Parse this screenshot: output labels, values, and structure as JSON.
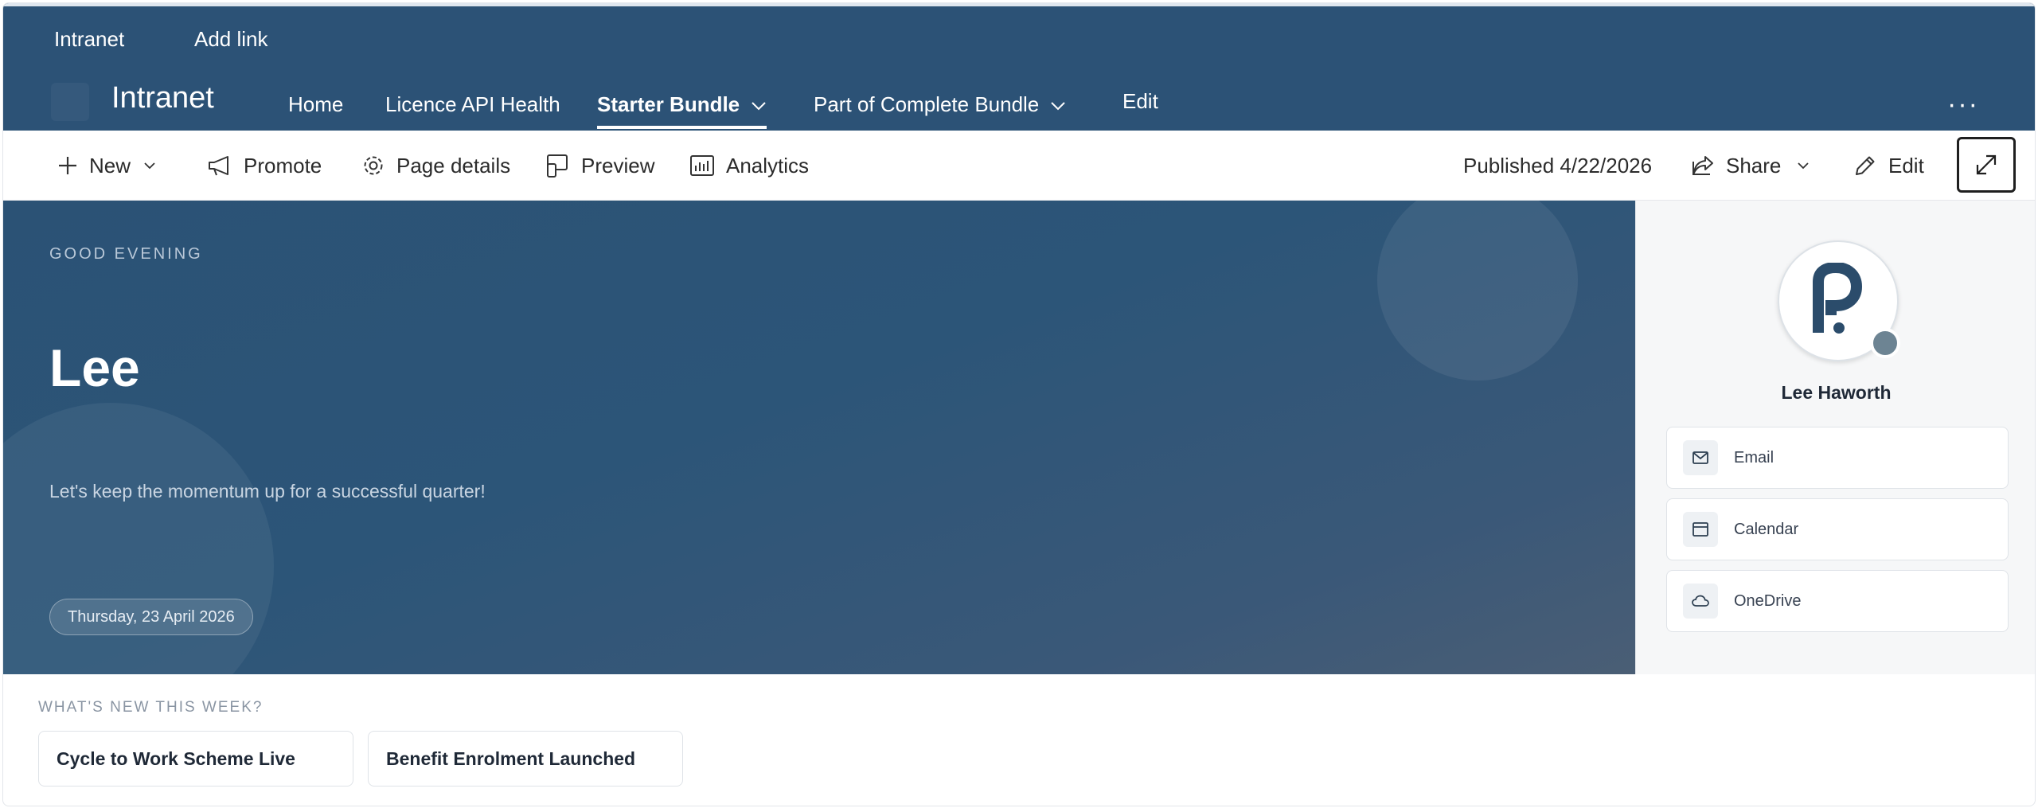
{
  "suite_bar": {
    "home_label": "Intranet",
    "add_link_label": "Add link"
  },
  "site_header": {
    "title": "Intranet",
    "nav": [
      {
        "label": "Home"
      },
      {
        "label": "Licence API Health"
      },
      {
        "label": "Starter Bundle"
      },
      {
        "label": "Part of Complete Bundle"
      },
      {
        "label": "Edit"
      }
    ],
    "more_label": "···"
  },
  "command_bar": {
    "new_label": "New",
    "promote_label": "Promote",
    "page_details_label": "Page details",
    "preview_label": "Preview",
    "analytics_label": "Analytics",
    "published_label": "Published 4/22/2026",
    "share_label": "Share",
    "edit_label": "Edit"
  },
  "hero": {
    "greeting": "GOOD EVENING",
    "name": "Lee",
    "message": "Let's keep the momentum up for a successful quarter!",
    "date": "Thursday, 23 April 2026"
  },
  "profile": {
    "name": "Lee Haworth",
    "links": [
      {
        "label": "Email",
        "icon": "mail-icon"
      },
      {
        "label": "Calendar",
        "icon": "calendar-icon"
      },
      {
        "label": "OneDrive",
        "icon": "cloud-icon"
      }
    ]
  },
  "whats_new": {
    "title": "WHAT'S NEW THIS WEEK?",
    "items": [
      {
        "label": "Cycle to Work Scheme Live"
      },
      {
        "label": "Benefit Enrolment Launched"
      }
    ]
  },
  "colors": {
    "brand": "#2c5276",
    "hero_gradient_end": "#4a5e75",
    "presence": "#6d8493"
  }
}
